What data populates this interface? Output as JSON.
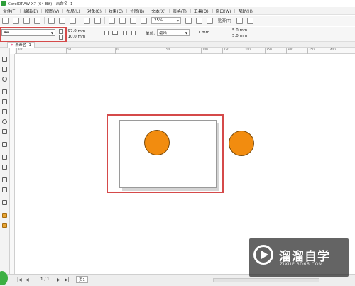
{
  "window": {
    "title": "CorelDRAW X7 (64-Bit) - 未命名 -1"
  },
  "menu": [
    "文件(F)",
    "编辑(E)",
    "视图(V)",
    "布局(L)",
    "对象(C)",
    "效果(C)",
    "位图(B)",
    "文本(X)",
    "表格(T)",
    "工具(O)",
    "窗口(W)",
    "帮助(H)"
  ],
  "toolbar": {
    "zoom_value": "25%",
    "snap_label": "贴齐(T)"
  },
  "property_bar": {
    "page_size": "A4",
    "width": "297.0 mm",
    "height": "210.0 mm",
    "units_label": "单位:",
    "units_value": "毫米",
    "nudge_value": ".1 mm",
    "dup_x": "5.0 mm",
    "dup_y": "5.0 mm"
  },
  "document_tab": "未命名 -1",
  "ruler_ticks": [
    "100",
    "50",
    "0",
    "50",
    "100",
    "150",
    "200",
    "250",
    "300",
    "350",
    "400"
  ],
  "status": {
    "page_counter": "1 / 1",
    "page_tab": "页1"
  },
  "watermark": {
    "brand": "溜溜自学",
    "url": "ZIXUE.3D66.COM"
  },
  "colors": {
    "circle_fill": "#f28c0f",
    "annotation": "#d54a4a",
    "app_icon": "#2e9e3a"
  }
}
